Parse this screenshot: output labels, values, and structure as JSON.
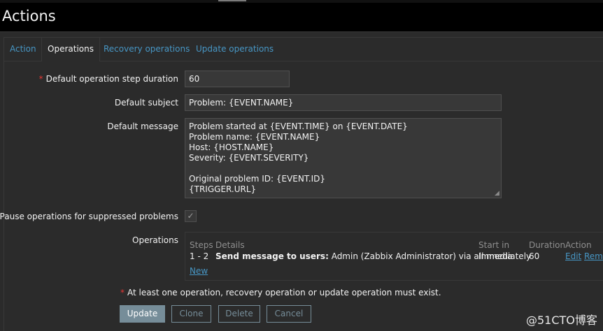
{
  "page": {
    "title": "Actions"
  },
  "tabs": [
    {
      "label": "Action",
      "active": false
    },
    {
      "label": "Operations",
      "active": true
    },
    {
      "label": "Recovery operations",
      "active": false
    },
    {
      "label": "Update operations",
      "active": false
    }
  ],
  "form": {
    "required_mark": "*",
    "step_duration": {
      "label": "Default operation step duration",
      "value": "60"
    },
    "subject": {
      "label": "Default subject",
      "value": "Problem: {EVENT.NAME}"
    },
    "message": {
      "label": "Default message",
      "lines": [
        "Problem started at {EVENT.TIME} on {EVENT.DATE}",
        "Problem name: {EVENT.NAME}",
        "Host: {HOST.NAME}",
        "Severity: {EVENT.SEVERITY}",
        "",
        "Original problem ID: {EVENT.ID}",
        "{TRIGGER.URL}"
      ]
    },
    "pause_suppressed": {
      "label": "Pause operations for suppressed problems",
      "checked": true,
      "check_glyph": "✓"
    },
    "operations": {
      "label": "Operations",
      "headers": {
        "steps": "Steps",
        "details": "Details",
        "start_in": "Start in",
        "duration": "Duration",
        "action": "Action"
      },
      "rows": [
        {
          "steps": "1 - 2",
          "details_bold": "Send message to users:",
          "details_rest": " Admin (Zabbix Administrator) via all media",
          "start_in": "Immediately",
          "duration": "60",
          "edit": "Edit",
          "remove": "Rem"
        }
      ],
      "new_link": "New"
    },
    "warning": "At least one operation, recovery operation or update operation must exist."
  },
  "buttons": {
    "update": "Update",
    "clone": "Clone",
    "delete": "Delete",
    "cancel": "Cancel"
  },
  "watermark": "@51CTO博客",
  "colors": {
    "link": "#4796c4",
    "required": "#e33734",
    "button": "#768d99",
    "background": "#2b2b2b"
  }
}
